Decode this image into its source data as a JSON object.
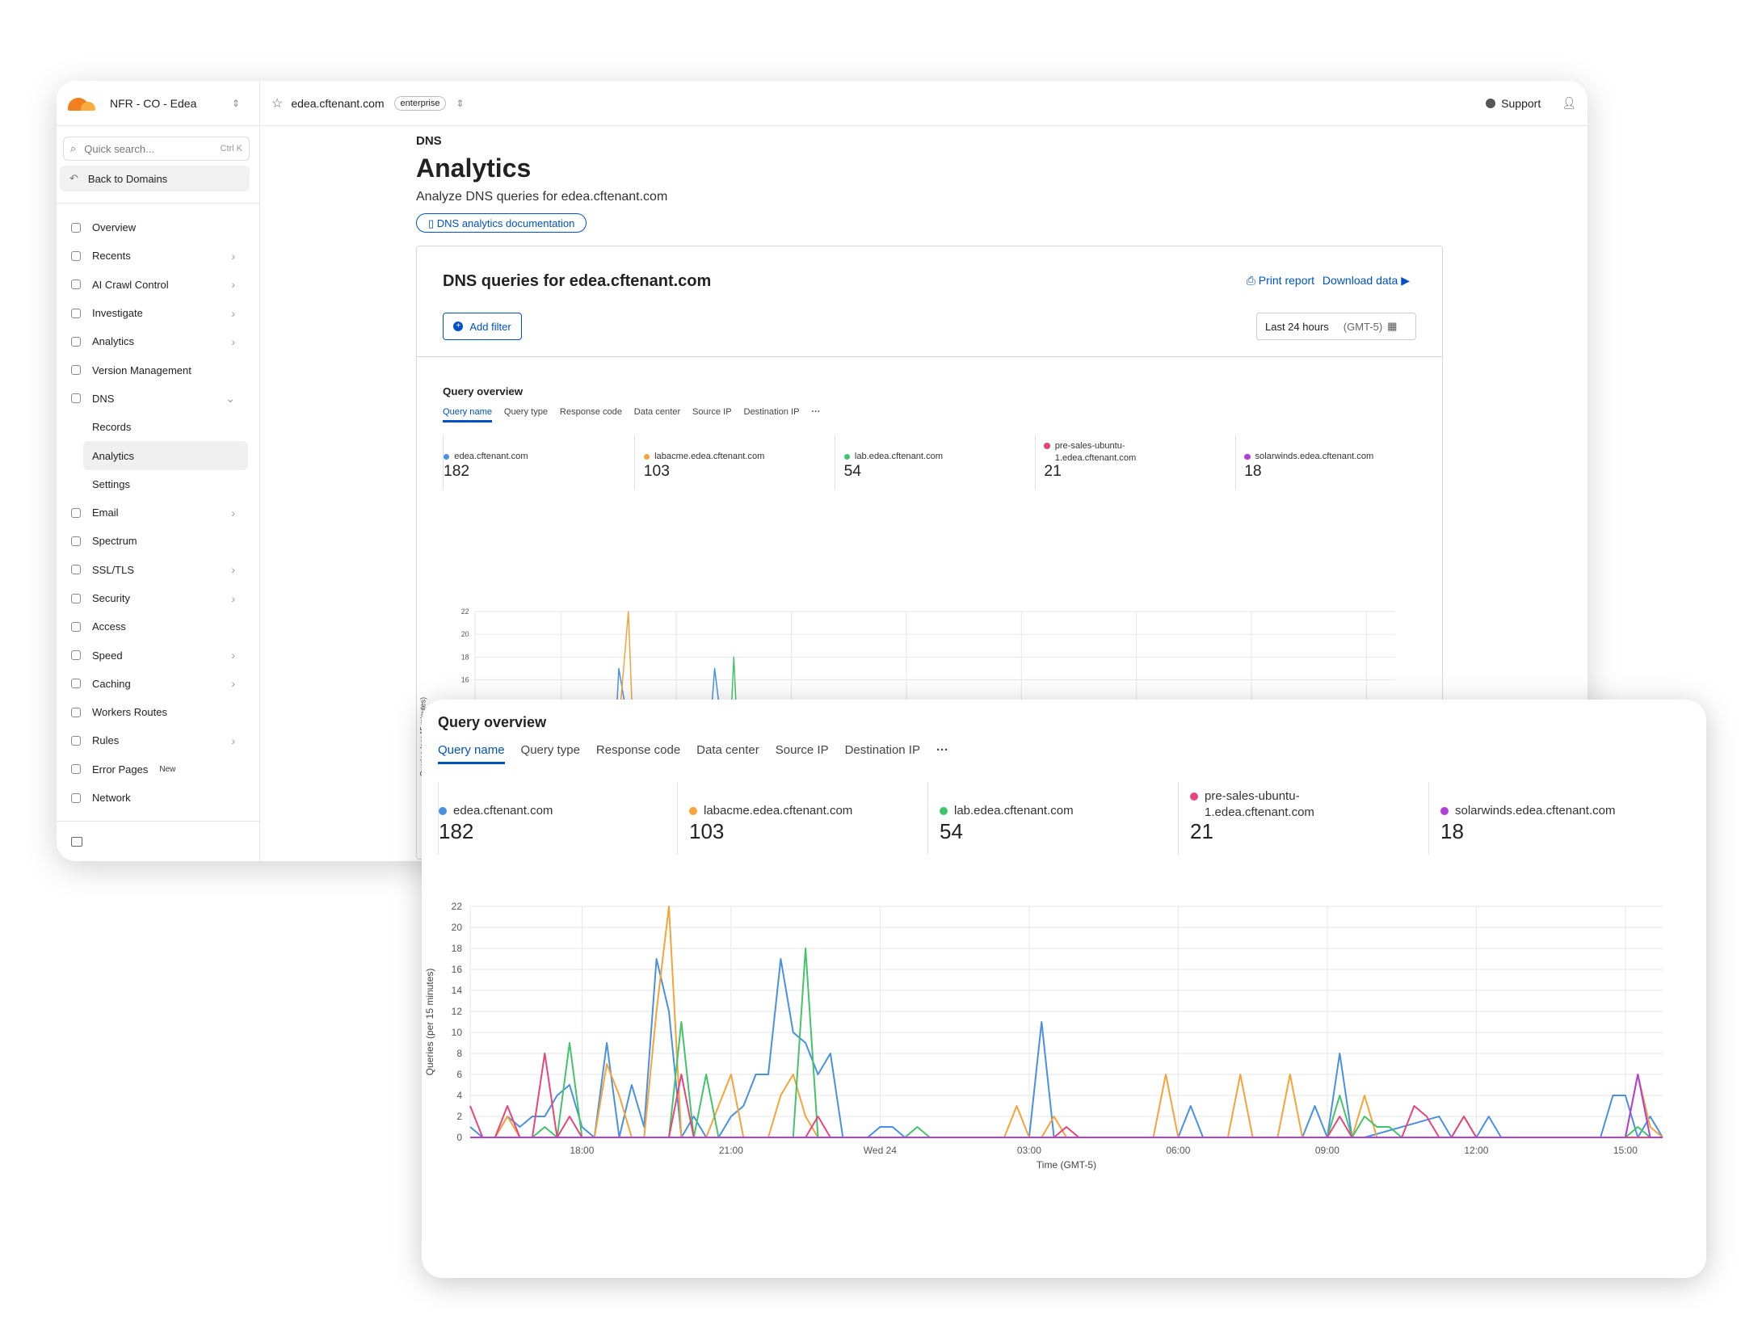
{
  "account": {
    "name": "NFR - CO - Edea"
  },
  "topbar": {
    "domain": "edea.cftenant.com",
    "plan_badge": "enterprise",
    "support": "Support"
  },
  "sidebar": {
    "search_placeholder": "Quick search...",
    "search_shortcut": "Ctrl K",
    "back": "Back to Domains",
    "items": [
      {
        "label": "Overview",
        "chevron": false
      },
      {
        "label": "Recents",
        "chevron": true
      },
      {
        "label": "AI Crawl Control",
        "chevron": true
      },
      {
        "label": "Investigate",
        "chevron": true
      },
      {
        "label": "Analytics",
        "chevron": true
      },
      {
        "label": "Version Management",
        "chevron": false
      },
      {
        "label": "DNS",
        "chevron": true,
        "expanded": true
      },
      {
        "label": "Records",
        "sub": true
      },
      {
        "label": "Analytics",
        "sub": true,
        "active": true
      },
      {
        "label": "Settings",
        "sub": true
      },
      {
        "label": "Email",
        "chevron": true
      },
      {
        "label": "Spectrum",
        "chevron": false
      },
      {
        "label": "SSL/TLS",
        "chevron": true
      },
      {
        "label": "Security",
        "chevron": true
      },
      {
        "label": "Access",
        "chevron": false
      },
      {
        "label": "Speed",
        "chevron": true
      },
      {
        "label": "Caching",
        "chevron": true
      },
      {
        "label": "Workers Routes",
        "chevron": false
      },
      {
        "label": "Rules",
        "chevron": true
      },
      {
        "label": "Error Pages",
        "chevron": false,
        "badge": "New"
      },
      {
        "label": "Network",
        "chevron": false
      }
    ]
  },
  "page": {
    "breadcrumb": "DNS",
    "title": "Analytics",
    "subtitle": "Analyze DNS queries for edea.cftenant.com",
    "doc_link": "DNS analytics documentation",
    "card_title": "DNS queries for edea.cftenant.com",
    "print_report": "Print report",
    "download_data": "Download data",
    "add_filter": "Add filter",
    "time_range": "Last 24 hours",
    "timezone": "(GMT-5)"
  },
  "query_overview": {
    "title": "Query overview",
    "tabs": [
      "Query name",
      "Query type",
      "Response code",
      "Data center",
      "Source IP",
      "Destination IP"
    ],
    "more": "···",
    "stats": [
      {
        "name": "edea.cftenant.com",
        "value": "182",
        "color": "#4a90e2"
      },
      {
        "name": "labacme.edea.cftenant.com",
        "value": "103",
        "color": "#f5a33a"
      },
      {
        "name": "lab.edea.cftenant.com",
        "value": "54",
        "color": "#43c46b"
      },
      {
        "name": "pre-sales-ubuntu-1.edea.cftenant.com",
        "name_line1": "pre-sales-ubuntu-",
        "name_line2": "1.edea.cftenant.com",
        "value": "21",
        "color": "#e8457c"
      },
      {
        "name": "solarwinds.edea.cftenant.com",
        "value": "18",
        "color": "#b040d8"
      }
    ]
  },
  "chart_data": {
    "type": "line",
    "xlabel": "Time (GMT-5)",
    "ylabel": "Queries (per 15 minutes)",
    "ylim": [
      0,
      22
    ],
    "yticks": [
      0,
      2,
      4,
      6,
      8,
      10,
      12,
      14,
      16,
      18,
      20,
      22
    ],
    "xticks": [
      {
        "label": "18:00",
        "t": 2.25
      },
      {
        "label": "21:00",
        "t": 5.25
      },
      {
        "label": "Wed 24",
        "t": 8.25
      },
      {
        "label": "03:00",
        "t": 11.25
      },
      {
        "label": "06:00",
        "t": 14.25
      },
      {
        "label": "09:00",
        "t": 17.25
      },
      {
        "label": "12:00",
        "t": 20.25
      },
      {
        "label": "15:00",
        "t": 23.25
      }
    ],
    "grid": true,
    "series": [
      {
        "name": "edea.cftenant.com",
        "color": "#4a90e2",
        "points": [
          [
            0,
            1
          ],
          [
            0.25,
            0
          ],
          [
            0.5,
            0
          ],
          [
            0.75,
            2
          ],
          [
            1,
            1
          ],
          [
            1.25,
            2
          ],
          [
            1.5,
            2
          ],
          [
            1.75,
            4
          ],
          [
            2,
            5
          ],
          [
            2.25,
            1
          ],
          [
            2.5,
            0
          ],
          [
            2.75,
            9
          ],
          [
            3,
            0
          ],
          [
            3.25,
            5
          ],
          [
            3.5,
            1
          ],
          [
            3.75,
            17
          ],
          [
            4,
            12
          ],
          [
            4.25,
            0
          ],
          [
            4.5,
            2
          ],
          [
            4.75,
            0
          ],
          [
            5,
            0
          ],
          [
            5.25,
            2
          ],
          [
            5.5,
            3
          ],
          [
            5.75,
            6
          ],
          [
            6,
            6
          ],
          [
            6.25,
            17
          ],
          [
            6.5,
            10
          ],
          [
            6.75,
            9
          ],
          [
            7,
            6
          ],
          [
            7.25,
            8
          ],
          [
            7.5,
            0
          ],
          [
            8,
            0
          ],
          [
            8.25,
            1
          ],
          [
            8.5,
            1
          ],
          [
            8.75,
            0
          ],
          [
            11,
            0
          ],
          [
            11.25,
            0
          ],
          [
            11.5,
            11
          ],
          [
            11.75,
            0
          ],
          [
            14.25,
            0
          ],
          [
            14.5,
            3
          ],
          [
            14.75,
            0
          ],
          [
            16.75,
            0
          ],
          [
            17,
            3
          ],
          [
            17.25,
            0
          ],
          [
            17.5,
            8
          ],
          [
            17.75,
            0
          ],
          [
            18,
            0
          ],
          [
            19.5,
            2
          ],
          [
            19.75,
            0
          ],
          [
            20,
            0
          ],
          [
            20.25,
            0
          ],
          [
            20.5,
            2
          ],
          [
            20.75,
            0
          ],
          [
            22.75,
            0
          ],
          [
            23,
            4
          ],
          [
            23.25,
            4
          ],
          [
            23.5,
            0
          ],
          [
            23.75,
            2
          ],
          [
            24,
            0
          ]
        ]
      },
      {
        "name": "labacme.edea.cftenant.com",
        "color": "#f5a33a",
        "points": [
          [
            0,
            0
          ],
          [
            0.5,
            0
          ],
          [
            0.75,
            2
          ],
          [
            1,
            0
          ],
          [
            2.25,
            0
          ],
          [
            2.5,
            0
          ],
          [
            2.75,
            7
          ],
          [
            3,
            4
          ],
          [
            3.25,
            0
          ],
          [
            3.5,
            0
          ],
          [
            3.75,
            12
          ],
          [
            4,
            22
          ],
          [
            4.25,
            0
          ],
          [
            4.5,
            0
          ],
          [
            4.75,
            0
          ],
          [
            5,
            3
          ],
          [
            5.25,
            6
          ],
          [
            5.5,
            0
          ],
          [
            6,
            0
          ],
          [
            6.25,
            4
          ],
          [
            6.5,
            6
          ],
          [
            6.75,
            2
          ],
          [
            7,
            0
          ],
          [
            10.75,
            0
          ],
          [
            11,
            3
          ],
          [
            11.25,
            0
          ],
          [
            11.5,
            0
          ],
          [
            11.75,
            2
          ],
          [
            12,
            0
          ],
          [
            13.75,
            0
          ],
          [
            14,
            6
          ],
          [
            14.25,
            0
          ],
          [
            15.25,
            0
          ],
          [
            15.5,
            6
          ],
          [
            15.75,
            0
          ],
          [
            16.25,
            0
          ],
          [
            16.5,
            6
          ],
          [
            16.75,
            0
          ],
          [
            17.75,
            0
          ],
          [
            18,
            4
          ],
          [
            18.25,
            0
          ],
          [
            23.25,
            0
          ],
          [
            23.5,
            6
          ],
          [
            23.75,
            1
          ],
          [
            24,
            0
          ]
        ]
      },
      {
        "name": "lab.edea.cftenant.com",
        "color": "#43c46b",
        "points": [
          [
            0,
            0
          ],
          [
            1.25,
            0
          ],
          [
            1.5,
            1
          ],
          [
            1.75,
            0
          ],
          [
            2,
            9
          ],
          [
            2.25,
            0
          ],
          [
            4,
            0
          ],
          [
            4.25,
            11
          ],
          [
            4.5,
            0
          ],
          [
            4.75,
            6
          ],
          [
            5,
            0
          ],
          [
            6.5,
            0
          ],
          [
            6.75,
            18
          ],
          [
            7,
            0
          ],
          [
            8.75,
            0
          ],
          [
            9,
            1
          ],
          [
            9.25,
            0
          ],
          [
            11.25,
            0
          ],
          [
            11.5,
            0
          ],
          [
            17.25,
            0
          ],
          [
            17.5,
            4
          ],
          [
            17.75,
            0
          ],
          [
            18,
            2
          ],
          [
            18.25,
            1
          ],
          [
            18.5,
            1
          ],
          [
            18.75,
            0
          ],
          [
            19.75,
            0
          ],
          [
            20,
            2
          ],
          [
            20.25,
            0
          ],
          [
            23.25,
            0
          ],
          [
            23.5,
            1
          ],
          [
            23.75,
            0
          ],
          [
            24,
            0
          ]
        ]
      },
      {
        "name": "pre-sales-ubuntu-1.edea.cftenant.com",
        "color": "#e8457c",
        "points": [
          [
            0,
            3
          ],
          [
            0.25,
            0
          ],
          [
            0.5,
            0
          ],
          [
            0.75,
            3
          ],
          [
            1,
            0
          ],
          [
            1.25,
            0
          ],
          [
            1.5,
            8
          ],
          [
            1.75,
            0
          ],
          [
            2,
            2
          ],
          [
            2.25,
            0
          ],
          [
            4,
            0
          ],
          [
            4.25,
            6
          ],
          [
            4.5,
            0
          ],
          [
            6.75,
            0
          ],
          [
            7,
            2
          ],
          [
            7.25,
            0
          ],
          [
            11.75,
            0
          ],
          [
            12,
            1
          ],
          [
            12.25,
            0
          ],
          [
            17.25,
            0
          ],
          [
            17.5,
            2
          ],
          [
            17.75,
            0
          ],
          [
            18.75,
            0
          ],
          [
            19,
            3
          ],
          [
            19.25,
            2
          ],
          [
            19.5,
            0
          ],
          [
            19.75,
            0
          ],
          [
            20,
            2
          ],
          [
            20.25,
            0
          ],
          [
            20.5,
            0
          ],
          [
            24,
            0
          ]
        ]
      },
      {
        "name": "solarwinds.edea.cftenant.com",
        "color": "#b040d8",
        "points": [
          [
            0,
            0
          ],
          [
            23.25,
            0
          ],
          [
            23.5,
            6
          ],
          [
            23.75,
            0
          ],
          [
            24,
            0
          ]
        ]
      }
    ]
  }
}
